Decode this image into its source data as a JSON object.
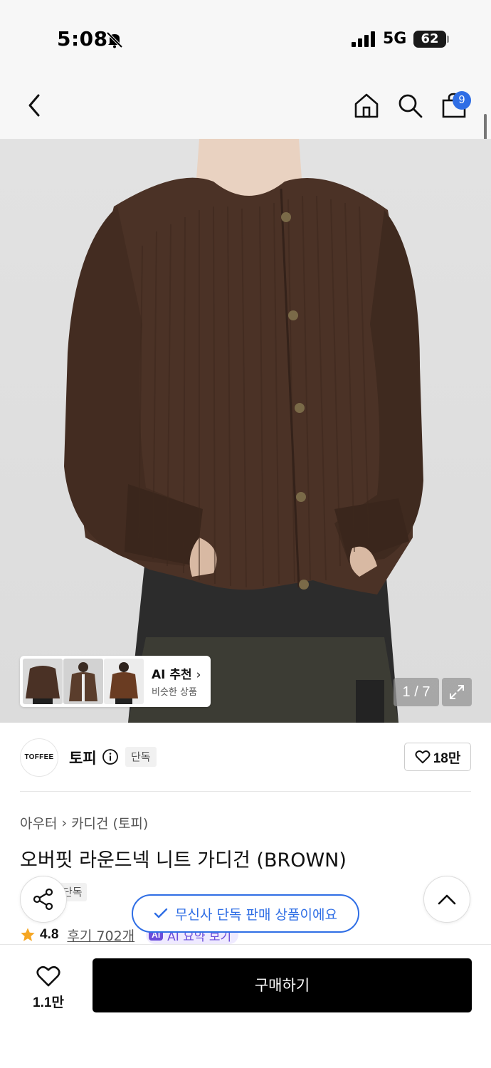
{
  "status_bar": {
    "time": "5:08",
    "network": "5G",
    "battery": "62"
  },
  "nav": {
    "cart_count": "9"
  },
  "gallery": {
    "ai_reco_title": "AI 추천",
    "ai_reco_subtitle": "비슷한 상품",
    "page_indicator": "1 / 7"
  },
  "brand": {
    "logo_text": "TOFFEE",
    "name": "토피",
    "tag": "단독",
    "likes": "18만"
  },
  "product": {
    "breadcrumb": [
      "아우터",
      "카디건 (토피)"
    ],
    "title": "오버핏 라운드넥 니트 가디건 (BROWN)",
    "tag": "단독",
    "rating": "4.8",
    "reviews": "후기 702개",
    "ai_chip": "AI",
    "ai_summary": "AI 요약 보기"
  },
  "toast": {
    "message": "무신사 단독 판매 상품이에요"
  },
  "bottom": {
    "wish_count": "1.1만",
    "buy_label": "구매하기"
  },
  "colors": {
    "accent_blue": "#2f6ee5",
    "sweater_brown": "#4b3226",
    "ai_purple": "#6a4ddb",
    "star": "#f5a623"
  }
}
